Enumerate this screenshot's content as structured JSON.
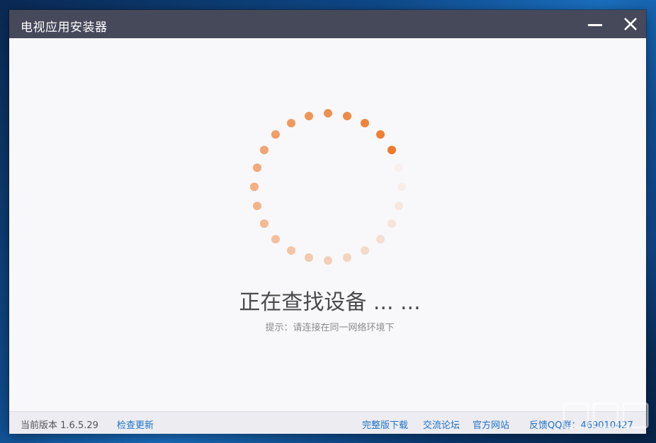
{
  "window": {
    "title": "电视应用安装器",
    "minimize_icon": "minimize-icon",
    "close_icon": "close-icon"
  },
  "main": {
    "status_text": "正在查找设备 ... ...",
    "hint_text": "提示：请连接在同一网络环境下",
    "spinner_icon": "loading-spinner-icon",
    "accent_color": "#ee7a2a"
  },
  "footer": {
    "version_label": "当前版本 1.6.5.29",
    "check_update_link": "检查更新",
    "full_download_link": "完整版下载",
    "forum_link": "交流论坛",
    "official_site_link": "官方网站",
    "feedback_qq": "反馈QQ群：469010427",
    "link_color": "#1f72c6"
  },
  "overlay": {
    "watermark": "下载吧",
    "watermark_url": "www.xiazaiba.com"
  }
}
